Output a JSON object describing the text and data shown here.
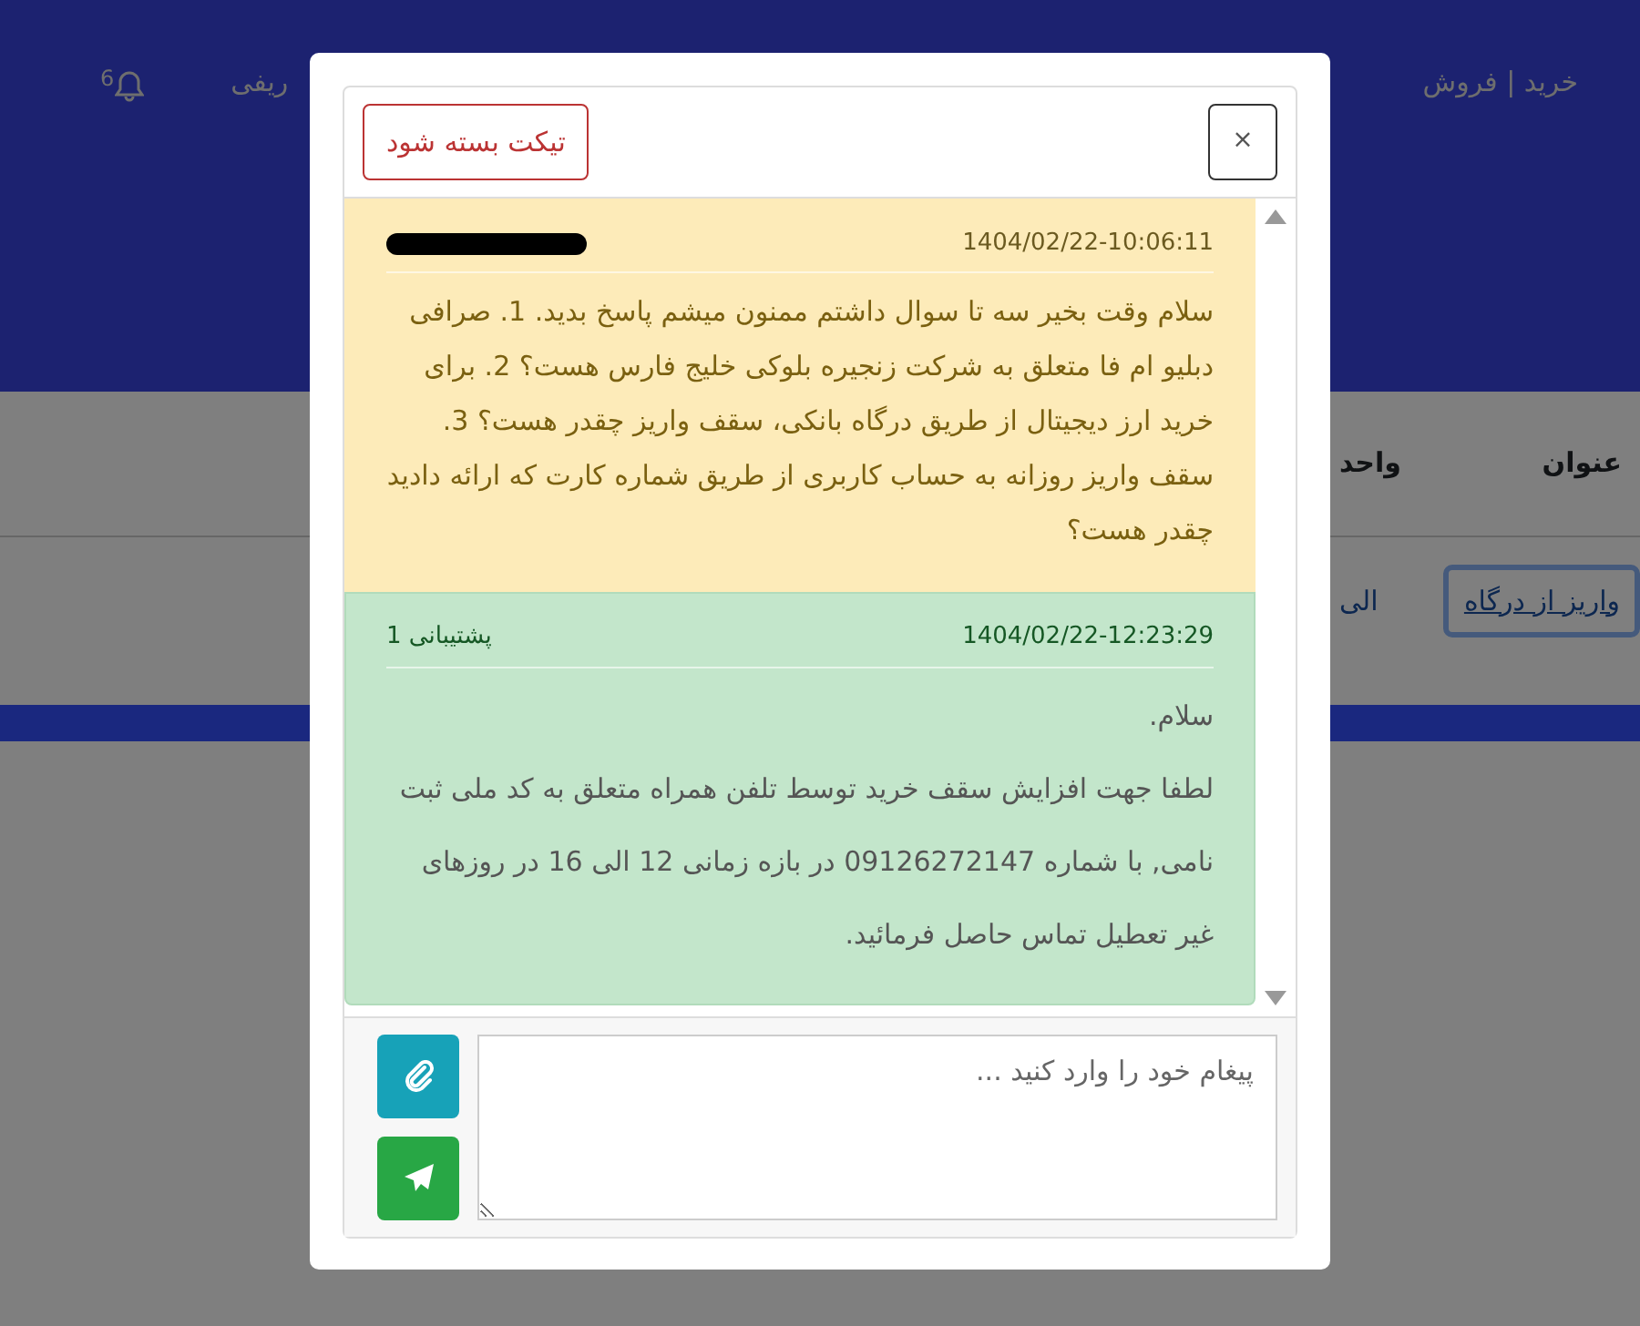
{
  "header": {
    "nav_link": "خرید | فروش",
    "partial_link": "ریفی",
    "notifications": {
      "count": "6"
    }
  },
  "table": {
    "columns": [
      "عنوان",
      "واحد"
    ],
    "row": {
      "title_link": "واریز از درگاه",
      "unit": "الی"
    }
  },
  "modal": {
    "close_button": "×",
    "close_ticket_button": "تیکت بسته شود",
    "messages": [
      {
        "kind": "user",
        "timestamp": "1404/02/22-10:06:11",
        "sender_redacted": true,
        "paragraphs": [
          "سلام وقت بخیر سه تا سوال داشتم ممنون میشم پاسخ بدید. 1. صرافی دبلیو ام فا متعلق به شرکت زنجیره بلوکی خلیج فارس هست؟ 2. برای خرید ارز دیجیتال از طریق درگاه بانکی، سقف واریز چقدر هست؟ 3. سقف واریز روزانه به حساب کاربری از طریق شماره کارت که ارائه دادید چقدر هست؟"
        ]
      },
      {
        "kind": "support",
        "timestamp": "1404/02/22-12:23:29",
        "sender": "پشتیبانی 1",
        "paragraphs": [
          "سلام.",
          "لطفا جهت افزایش سقف خرید توسط تلفن همراه متعلق به کد ملی ثبت نامی, با شماره 09126272147 در بازه زمانی 12 الی 16 در روزهای غیر تعطیل تماس حاصل فرمائید."
        ]
      }
    ],
    "composer": {
      "placeholder": "پیغام خود را وارد کنید ..."
    }
  }
}
